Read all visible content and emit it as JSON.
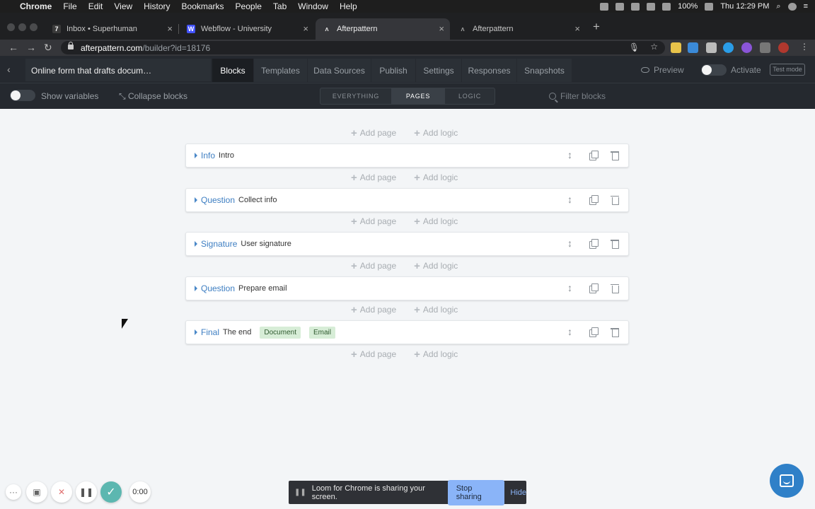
{
  "mac_menu": {
    "app": "Chrome",
    "items": [
      "File",
      "Edit",
      "View",
      "History",
      "Bookmarks",
      "People",
      "Tab",
      "Window",
      "Help"
    ],
    "battery": "100%",
    "clock": "Thu 12:29 PM"
  },
  "browser": {
    "tabs": [
      {
        "title": "Inbox • Superhuman",
        "icon": "superhuman-icon"
      },
      {
        "title": "Webflow - University",
        "icon": "webflow-icon"
      },
      {
        "title": "Afterpattern",
        "icon": "afterpattern-icon"
      },
      {
        "title": "Afterpattern",
        "icon": "afterpattern-icon"
      }
    ],
    "active_tab": 2,
    "url_host": "afterpattern.com",
    "url_path": "/builder?id=18176"
  },
  "app": {
    "doc_title": "Online form that drafts docum…",
    "nav_tabs": [
      "Blocks",
      "Templates",
      "Data Sources",
      "Publish",
      "Settings",
      "Responses",
      "Snapshots"
    ],
    "active_nav": "Blocks",
    "preview": "Preview",
    "activate": "Activate",
    "test_mode": "Test mode",
    "show_variables": "Show variables",
    "collapse_blocks": "Collapse blocks",
    "segments": [
      "EVERYTHING",
      "PAGES",
      "LOGIC"
    ],
    "active_segment": "PAGES",
    "filter_placeholder": "Filter blocks"
  },
  "builder": {
    "add_page": "Add page",
    "add_logic": "Add logic",
    "blocks": [
      {
        "type": "Info",
        "name": "Intro",
        "badges": []
      },
      {
        "type": "Question",
        "name": "Collect info",
        "badges": []
      },
      {
        "type": "Signature",
        "name": "User signature",
        "badges": []
      },
      {
        "type": "Question",
        "name": "Prepare email",
        "badges": []
      },
      {
        "type": "Final",
        "name": "The end",
        "badges": [
          "Document",
          "Email"
        ]
      }
    ]
  },
  "loom": {
    "timer": "0:00",
    "message": "Loom for Chrome is sharing your screen.",
    "stop_sharing": "Stop sharing",
    "hide": "Hide"
  },
  "colors": {
    "link_blue": "#3d7ec2",
    "badge_green": "#d7edd7",
    "header_dark": "#25292f"
  }
}
